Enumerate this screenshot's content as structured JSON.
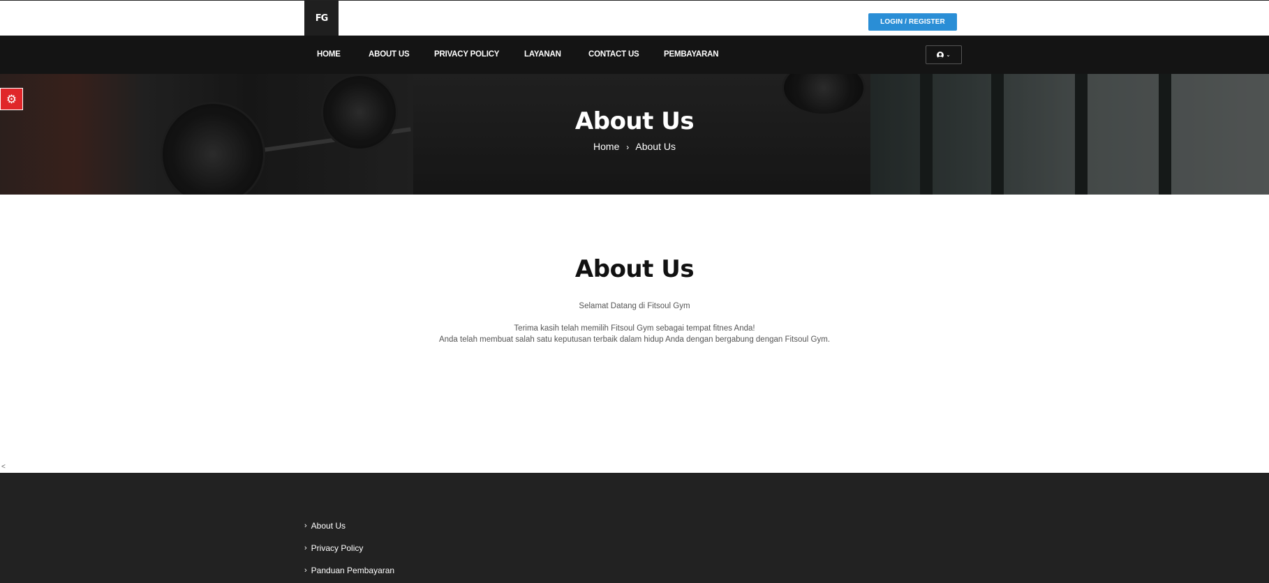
{
  "brand": {
    "logo_text": "FG"
  },
  "topbar": {
    "login_label": "LOGIN / REGISTER"
  },
  "nav": {
    "items": [
      {
        "label": "HOME"
      },
      {
        "label": "ABOUT US"
      },
      {
        "label": "PRIVACY POLICY"
      },
      {
        "label": "LAYANAN"
      },
      {
        "label": "CONTACT US"
      },
      {
        "label": "PEMBAYARAN"
      }
    ],
    "account_icon": "user-circle-icon",
    "dropdown_icon": "chevron-down-icon"
  },
  "hero": {
    "title": "About Us",
    "breadcrumb": {
      "home": "Home",
      "separator": "›",
      "current": "About Us"
    }
  },
  "settings": {
    "icon": "gear-icon",
    "color": "#e0262a"
  },
  "main": {
    "title": "About Us",
    "welcome": "Selamat Datang di Fitsoul Gym",
    "line1": "Terima kasih telah memilih Fitsoul Gym sebagai tempat fitnes Anda!",
    "line2": "Anda telah membuat salah satu keputusan terbaik dalam hidup Anda dengan bergabung dengan Fitsoul Gym."
  },
  "stray_char": "<",
  "footer": {
    "links": [
      {
        "label": "About Us"
      },
      {
        "label": "Privacy Policy"
      },
      {
        "label": "Panduan Pembayaran"
      }
    ]
  },
  "colors": {
    "accent": "#2a8ed6",
    "nav_bg": "#141414",
    "footer_bg": "#222222"
  }
}
